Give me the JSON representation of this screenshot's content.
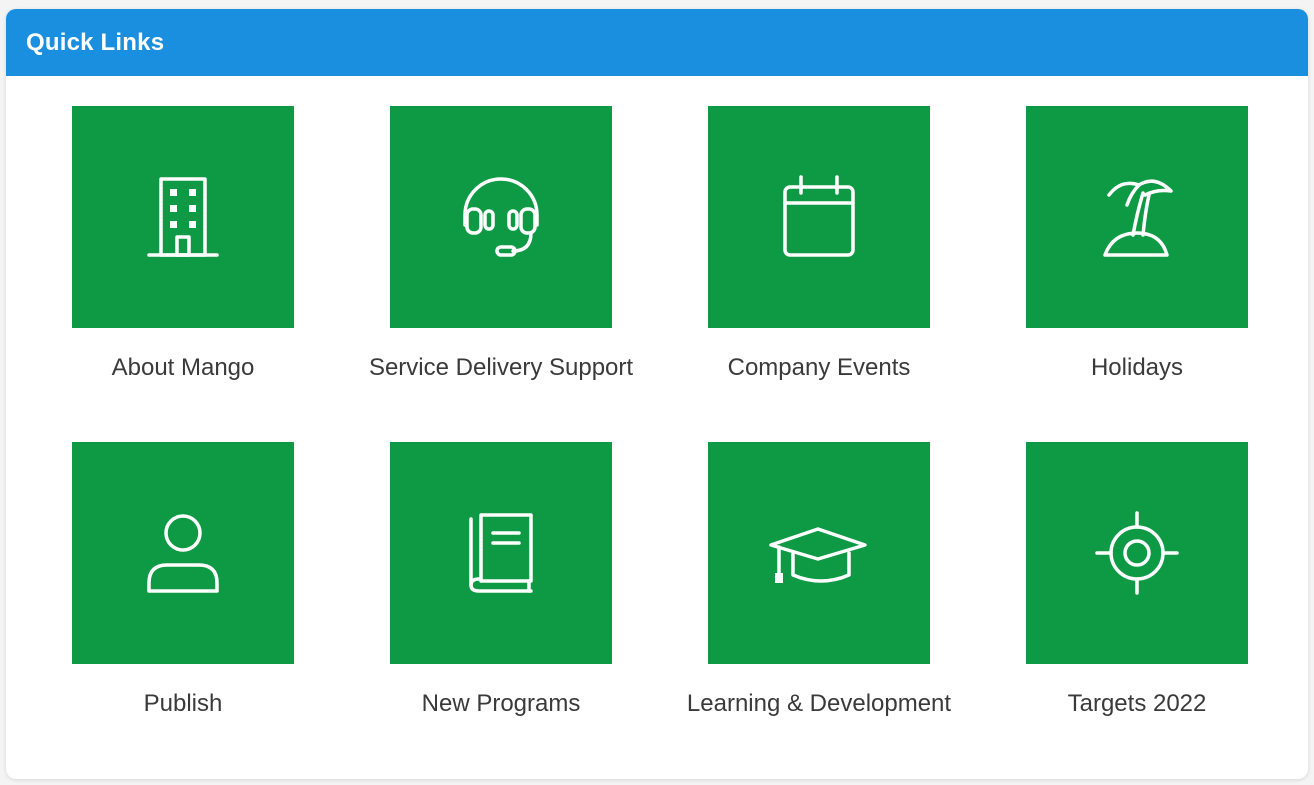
{
  "header": {
    "title": "Quick Links"
  },
  "colors": {
    "header_bg": "#1a8fe0",
    "tile_bg": "#0e9a44",
    "icon_stroke": "#ffffff",
    "label_text": "#3a3a3a"
  },
  "links": [
    {
      "label": "About Mango",
      "icon": "building-icon"
    },
    {
      "label": "Service Delivery Support",
      "icon": "headset-icon"
    },
    {
      "label": "Company Events",
      "icon": "calendar-icon"
    },
    {
      "label": "Holidays",
      "icon": "palm-tree-island-icon"
    },
    {
      "label": "Publish",
      "icon": "user-icon"
    },
    {
      "label": "New Programs",
      "icon": "book-icon"
    },
    {
      "label": "Learning & Development",
      "icon": "graduation-cap-icon"
    },
    {
      "label": "Targets 2022",
      "icon": "crosshair-target-icon"
    }
  ]
}
